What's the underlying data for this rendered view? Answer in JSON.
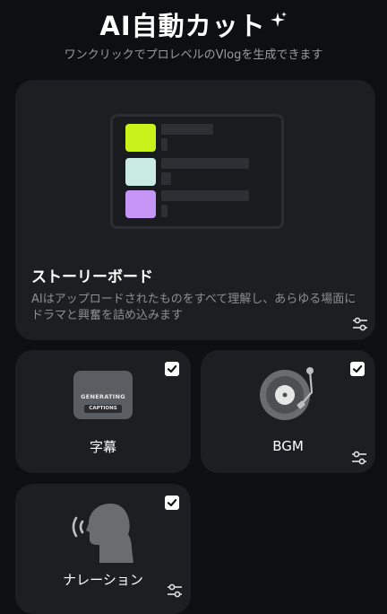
{
  "header": {
    "title": "AI自動カット",
    "subtitle": "ワンクリックでプロレベルのVlogを生成できます"
  },
  "storyboard": {
    "title": "ストーリーボード",
    "description": "AIはアップロードされたものをすべて理解し、あらゆる場面にドラマと興奮を詰め込みます",
    "swatch_colors": [
      "#c8f21a",
      "#c9ebe4",
      "#c495f5"
    ]
  },
  "features": [
    {
      "label": "字幕",
      "checked": true,
      "icon": "captions-icon",
      "tile_line1": "GENERATING",
      "tile_line2": "CAPTIONS"
    },
    {
      "label": "BGM",
      "checked": true,
      "icon": "turntable-icon"
    },
    {
      "label": "ナレーション",
      "checked": true,
      "icon": "speaking-head-icon"
    }
  ],
  "colors": {
    "background": "#0e0f10",
    "card": "#1c1e21",
    "accent": "#c8f21a"
  }
}
